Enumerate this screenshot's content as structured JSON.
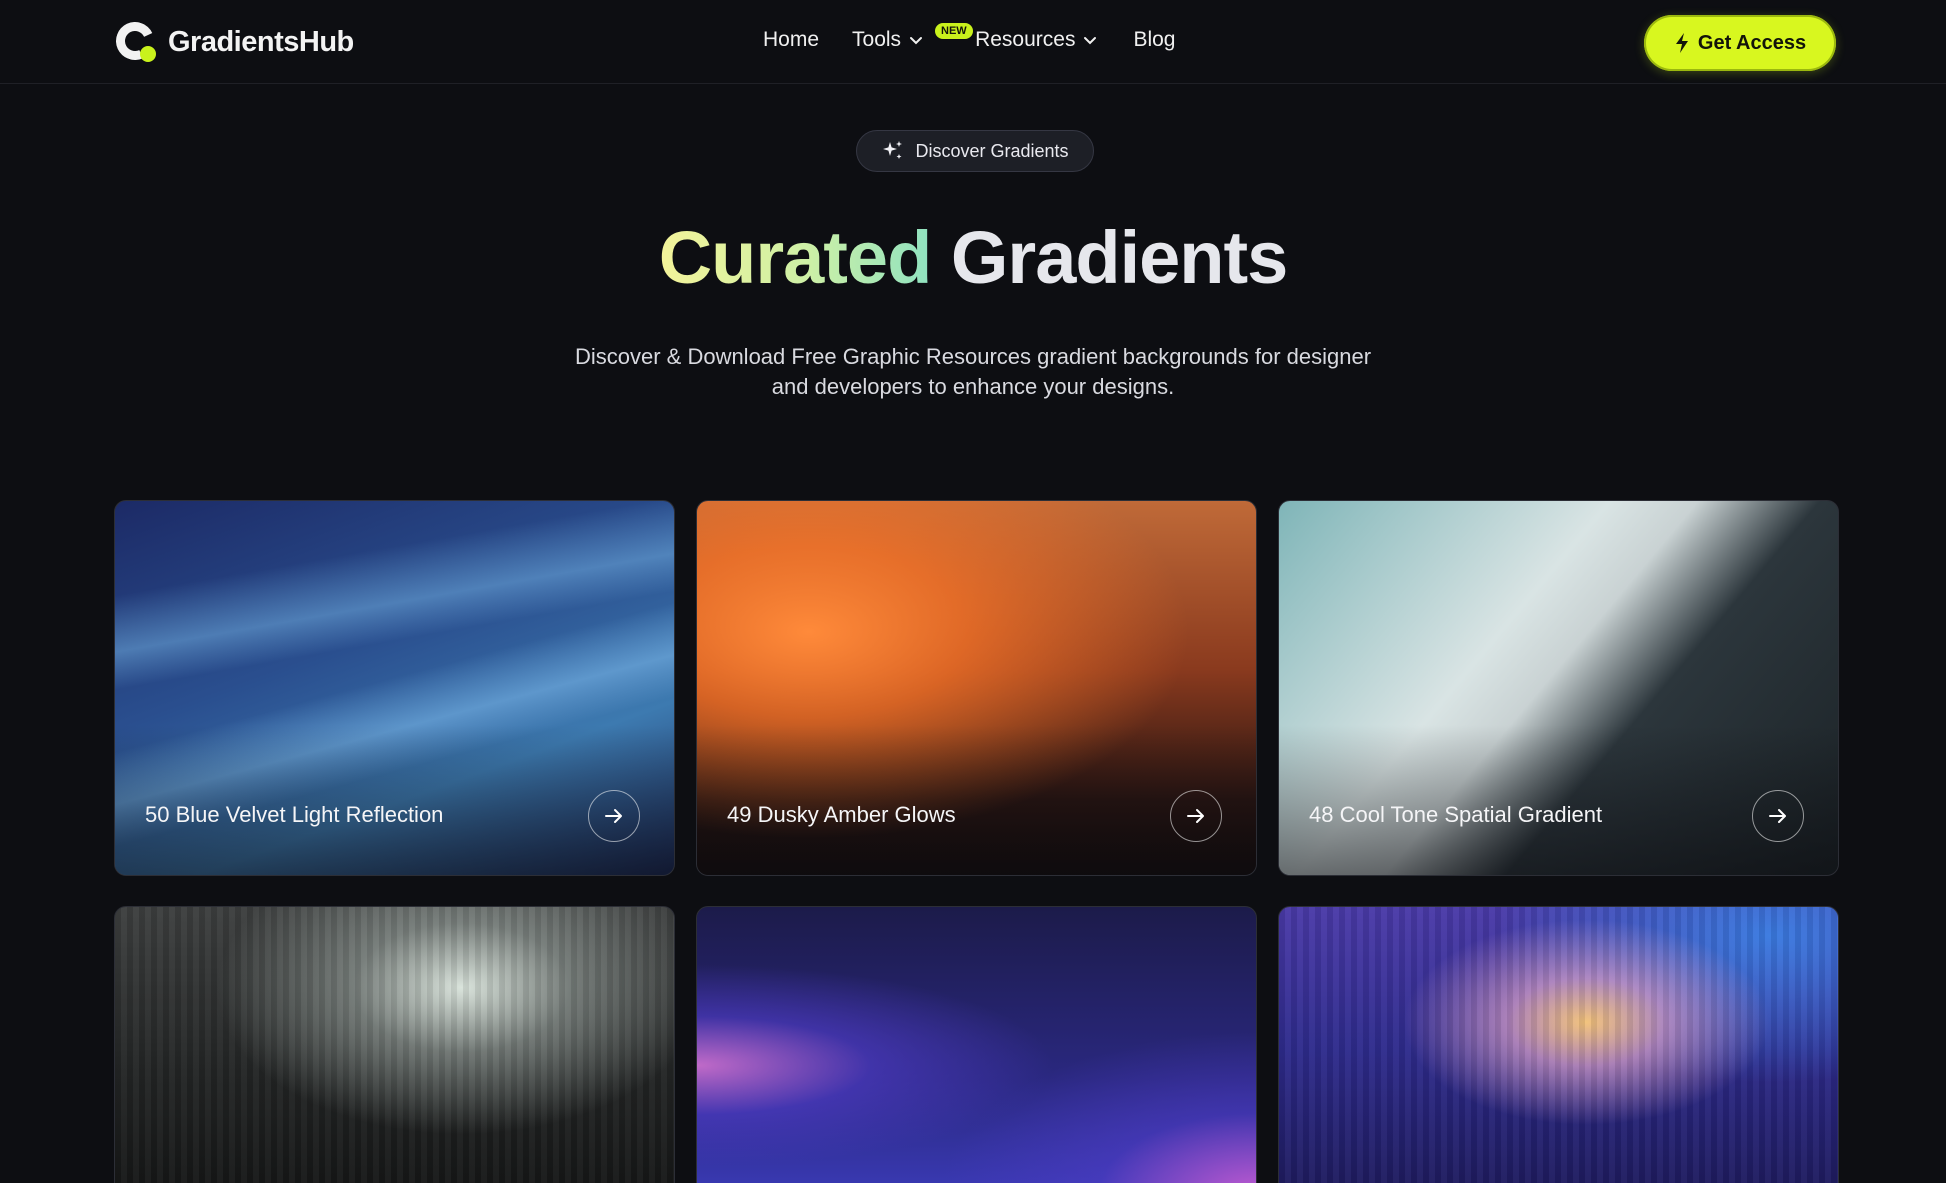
{
  "header": {
    "brand": "GradientsHub",
    "nav": {
      "home": "Home",
      "tools": "Tools",
      "tools_badge": "NEW",
      "resources": "Resources",
      "blog": "Blog"
    },
    "cta": "Get Access"
  },
  "hero": {
    "pill": "Discover Gradients",
    "title_accent": "Curated",
    "title_rest": "Gradients",
    "subtitle_line1": "Discover & Download Free Graphic Resources gradient backgrounds for designer",
    "subtitle_line2": "and developers to enhance your designs."
  },
  "cards": [
    {
      "title": "50 Blue Velvet Light Reflection"
    },
    {
      "title": "49 Dusky Amber Glows"
    },
    {
      "title": "48 Cool Tone Spatial Gradient"
    },
    {
      "title": ""
    },
    {
      "title": ""
    },
    {
      "title": ""
    }
  ],
  "colors": {
    "accent": "#d8f71f",
    "background": "#0d0e12"
  },
  "icons": [
    "sparkle-icon",
    "bolt-icon",
    "chevron-down-icon",
    "arrow-right-icon"
  ]
}
